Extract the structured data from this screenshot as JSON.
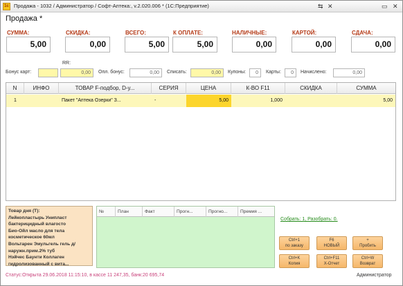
{
  "window": {
    "title": "Продажа - 1032 / Администратор / Софт-Аптека:, v.2.020.006 * (1С:Предприятие)",
    "icon": "1с",
    "controls": [
      "⇆",
      "✕",
      "▭",
      "✕"
    ]
  },
  "page_title": "Продажа *",
  "totals": [
    {
      "label": "СУММА:",
      "value": "5,00"
    },
    {
      "label": "СКИДКА:",
      "value": "0,00"
    },
    {
      "label": "ВСЕГО:",
      "value": "5,00"
    },
    {
      "label": "К ОПЛАТЕ:",
      "value": "5,00"
    },
    {
      "label": "НАЛИЧНЫЕ:",
      "value": "0,00"
    },
    {
      "label": "КАРТОЙ:",
      "value": "0,00"
    },
    {
      "label": "СДАЧА:",
      "value": "0,00"
    }
  ],
  "bonus": {
    "bonus_card_label": "Бонус карт:",
    "bonus_card_value": "",
    "rr_label": "RR:",
    "rr_value": "0,00",
    "opl_bonus_label": "Опл. бонус:",
    "opl_bonus_value": "0,00",
    "spisat_label": "Списать:",
    "spisat_value": "0,00",
    "kupony_label": "Купоны:",
    "kupony_value": "0",
    "karty_label": "Карты:",
    "karty_value": "0",
    "nachisleno_label": "Начислено:",
    "nachisleno_value": "0,00"
  },
  "grid": {
    "columns": [
      "N",
      "ИНФО",
      "ТОВАР  F-подбор, D-у...",
      "СЕРИЯ",
      "ЦЕНА",
      "К-ВО F11",
      "СКИДКА",
      "СУММА"
    ],
    "rows": [
      {
        "n": "1",
        "info": "",
        "tovar": "Пакет \"Аптека Озерки\" З...",
        "seria": "-",
        "cena": "5,00",
        "kvo": "1,000",
        "skidka": "",
        "summa": "5,00"
      }
    ]
  },
  "tovar_dnya": "Товар дня (Т):\nЛейкопластырь Унипласт бактерицидный влагосто\nБио-Ойл масло для тела косметическое 60мл\nВольтарен Эмульгель гель д/наружн.прим.2% туб\nНэйчес Баунти Коллаген гидролизованный с вита...",
  "plan_grid": {
    "columns": [
      "№",
      "План",
      "Факт",
      "Прогн...",
      "Прогно...",
      "Премия ..."
    ]
  },
  "link": "Собрать: 1, Разобрать: 0.",
  "actions": [
    {
      "line1": "Ctrl+1",
      "line2": "по заказу"
    },
    {
      "line1": "F6",
      "line2": "НОВЫЙ"
    },
    {
      "line1": "+",
      "line2": "Пробить"
    },
    {
      "line1": "Ctrl+K",
      "line2": "Копия"
    },
    {
      "line1": "Ctrl+F11",
      "line2": "X-Отчет"
    },
    {
      "line1": "Ctrl+W",
      "line2": "Возврат"
    }
  ],
  "status": "Статус:Открыта 29.06.2018 11:15:10, в кассе 11 247,35, банк:20 695,74",
  "user": "Администратор",
  "colors": {
    "accent_label": "#b53b18",
    "row_highlight": "#fdf7ba",
    "price_cell": "#fcd52c",
    "yellow_input": "#fff8a8",
    "tovar_bg": "#fbe3c3",
    "plan_bg": "#d0f5cc",
    "button_orange": "#f5b76a",
    "link_green": "#238a18",
    "status_pink": "#c8407a"
  }
}
